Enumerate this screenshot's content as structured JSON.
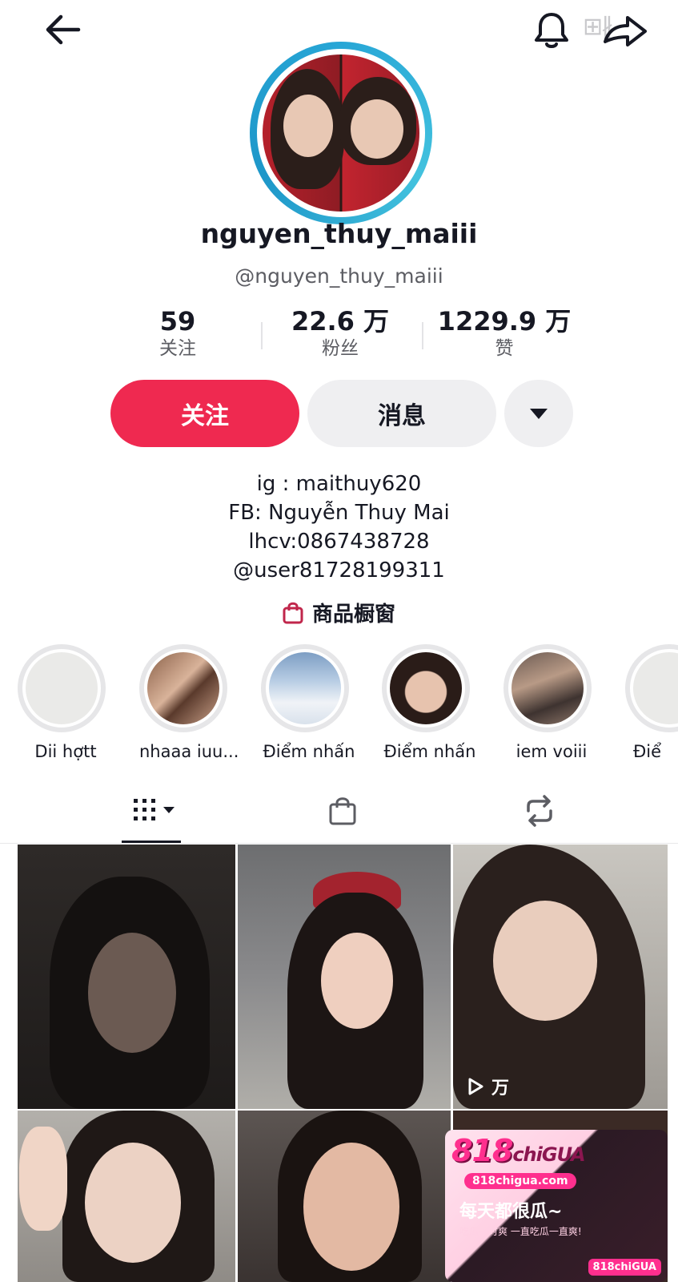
{
  "header": {
    "back_icon": "arrow-left-icon",
    "bell_icon": "bell-icon",
    "share_icon": "share-arrow-icon"
  },
  "profile": {
    "display_name": "nguyen_thuy_maiii",
    "handle": "@nguyen_thuy_maiii"
  },
  "stats": [
    {
      "value": "59",
      "label": "关注"
    },
    {
      "value": "22.6 万",
      "label": "粉丝"
    },
    {
      "value": "1229.9 万",
      "label": "赞"
    }
  ],
  "actions": {
    "follow_label": "关注",
    "message_label": "消息"
  },
  "bio": {
    "line1": "ig : maithuy620",
    "line2": "FB: Nguyễn Thuy Mai",
    "line3": "lhcv:0867438728",
    "line4": "@user81728199311"
  },
  "shop": {
    "label": "商品橱窗"
  },
  "highlights": [
    {
      "label": "Dii hợtt"
    },
    {
      "label": "nhaaa iuu..."
    },
    {
      "label": "Điểm nhấn"
    },
    {
      "label": "Điểm nhấn"
    },
    {
      "label": "iem voiii"
    },
    {
      "label": "Điể"
    }
  ],
  "tabs": [
    {
      "icon": "grid-icon"
    },
    {
      "icon": "shopping-bag-icon"
    },
    {
      "icon": "repost-icon"
    }
  ],
  "grid": {
    "video3_views": "万"
  },
  "ad": {
    "logo": "818",
    "logo_suffix": "chiGUA",
    "url": "818chigua.com",
    "slogan": "每天都很瓜~",
    "subline": "吃瓜一时爽 一直吃瓜一直爽!",
    "badge": "818chiGUA"
  },
  "colors": {
    "accent": "#ef2950",
    "ring": "#27a6d6",
    "text": "#161823",
    "secondary_text": "#5c5d63"
  }
}
